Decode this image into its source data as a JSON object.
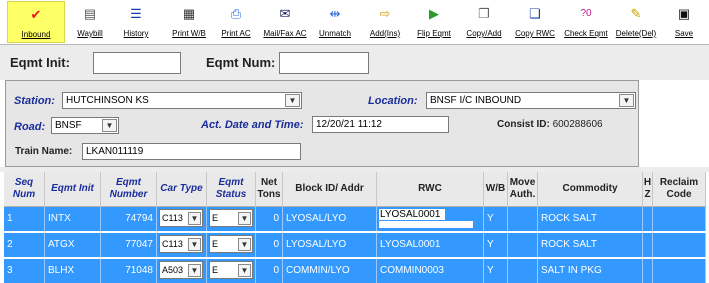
{
  "toolbar": {
    "buttons": [
      {
        "label": "Inbound",
        "icon": "checkmark-icon",
        "glyph": "✔",
        "color": "#e0141e",
        "active": true
      },
      {
        "label": "Waybill",
        "icon": "document-icon",
        "glyph": "▤",
        "color": "#555555"
      },
      {
        "label": "History",
        "icon": "list-icon",
        "glyph": "☰",
        "color": "#1a3fa8"
      },
      {
        "label": "Print W/B",
        "icon": "print-document-icon",
        "glyph": "▦",
        "color": "#333333"
      },
      {
        "label": "Print AC",
        "icon": "printer-icon",
        "glyph": "⎙",
        "color": "#2c6bd6"
      },
      {
        "label": "Mail/Fax AC",
        "icon": "fax-icon",
        "glyph": "✉",
        "color": "#1c1c5a"
      },
      {
        "label": "Unmatch",
        "icon": "unmatch-icon",
        "glyph": "⇹",
        "color": "#2c6bd6"
      },
      {
        "label": "Add(Ins)",
        "icon": "add-icon",
        "glyph": "⇨",
        "color": "#d4a017"
      },
      {
        "label": "Flip Eqmt",
        "icon": "flip-icon",
        "glyph": "▶",
        "color": "#2b9b2b"
      },
      {
        "label": "Copy/Add",
        "icon": "copy-add-icon",
        "glyph": "❐",
        "color": "#666666"
      },
      {
        "label": "Copy RWC",
        "icon": "copy-rwc-icon",
        "glyph": "❏",
        "color": "#1a3fa8"
      },
      {
        "label": "Check Eqmt",
        "icon": "check-eqmt-icon",
        "glyph": "?0",
        "color": "#c0198e"
      },
      {
        "label": "Delete(Del)",
        "icon": "eraser-icon",
        "glyph": "✎",
        "color": "#c9a400"
      },
      {
        "label": "Save",
        "icon": "save-icon",
        "glyph": "▣",
        "color": "#111111"
      }
    ]
  },
  "search": {
    "eqmt_init_label": "Eqmt Init:",
    "eqmt_init_value": "",
    "eqmt_num_label": "Eqmt Num:",
    "eqmt_num_value": ""
  },
  "details": {
    "station_label": "Station:",
    "station_value": "HUTCHINSON KS",
    "location_label": "Location:",
    "location_value": "BNSF I/C INBOUND",
    "road_label": "Road:",
    "road_value": "BNSF",
    "act_date_label": "Act. Date and Time:",
    "act_date_value": "12/20/21 11:12",
    "consist_label": "Consist ID:",
    "consist_value": "600288606",
    "train_label": "Train Name:",
    "train_value": "LKAN011119"
  },
  "grid": {
    "columns": [
      {
        "label": "Seq Num",
        "style": "blue"
      },
      {
        "label": "Eqmt Init",
        "style": "blue"
      },
      {
        "label": "Eqmt Number",
        "style": "blue"
      },
      {
        "label": "Car Type",
        "style": "blue"
      },
      {
        "label": "Eqmt Status",
        "style": "blue"
      },
      {
        "label": "Net Tons",
        "style": "dark"
      },
      {
        "label": "Block ID/ Addr",
        "style": "dark"
      },
      {
        "label": "RWC",
        "style": "dark"
      },
      {
        "label": "W/B",
        "style": "dark"
      },
      {
        "label": "Move Auth.",
        "style": "dark"
      },
      {
        "label": "Commodity",
        "style": "dark"
      },
      {
        "label": "H Z",
        "style": "dark"
      },
      {
        "label": "Reclaim Code",
        "style": "dark"
      }
    ],
    "rows": [
      {
        "seq": "1",
        "init": "INTX",
        "number": "74794",
        "car_type": "C113",
        "status": "E",
        "tons": "0",
        "block": "LYOSAL/LYO",
        "rwc": "LYOSAL0001",
        "wb": "Y",
        "move": "",
        "commodity": "ROCK SALT",
        "hz": "",
        "reclaim": ""
      },
      {
        "seq": "2",
        "init": "ATGX",
        "number": "77047",
        "car_type": "C113",
        "status": "E",
        "tons": "0",
        "block": "LYOSAL/LYO",
        "rwc": "LYOSAL0001",
        "wb": "Y",
        "move": "",
        "commodity": "ROCK SALT",
        "hz": "",
        "reclaim": ""
      },
      {
        "seq": "3",
        "init": "BLHX",
        "number": "71048",
        "car_type": "A503",
        "status": "E",
        "tons": "0",
        "block": "COMMIN/LYO",
        "rwc": "COMMIN0003",
        "wb": "Y",
        "move": "",
        "commodity": "SALT IN PKG",
        "hz": "",
        "reclaim": ""
      }
    ]
  }
}
